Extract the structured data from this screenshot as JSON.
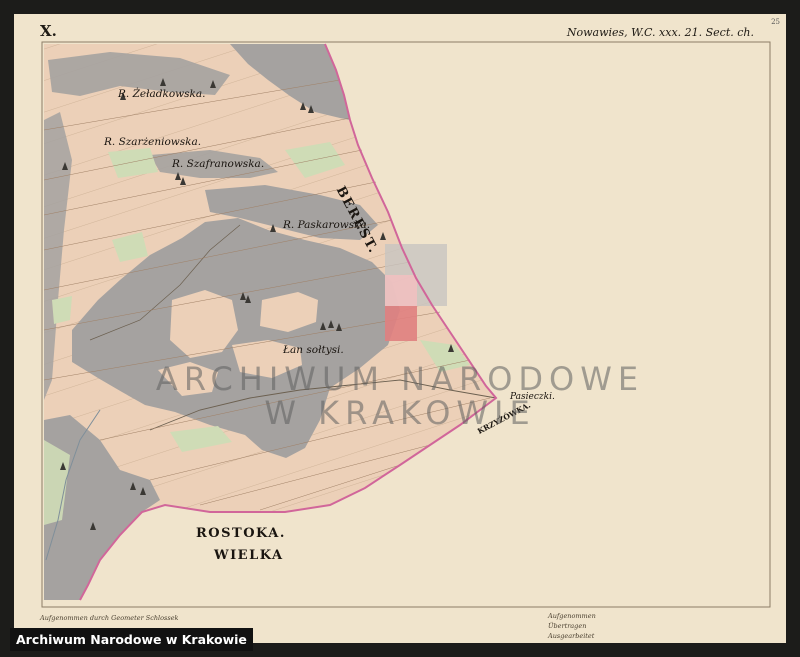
{
  "sheet": {
    "corner_label": "X.",
    "title": "Nowawies, W.C. xxx. 21. Sect. ch.",
    "page_number": "25"
  },
  "places": {
    "r_zeladkowska": "R. Żeładkowska.",
    "r_szarzeniowska": "R. Szarżeniowska.",
    "r_szafranowska": "R. Szafranowska.",
    "r_paskarowska": "R. Paskarowska.",
    "lan_soltysi": "Łan sołtysi.",
    "berest": "BEREST.",
    "pasieczki": "Pasieczki.",
    "krzyzowka": "KRZYŻÓWKA.",
    "rostoka": "ROSTOKA.",
    "wielka": "WIELKA"
  },
  "watermark": {
    "line1": "ARCHIWUM NARODOWE",
    "line2": "W KRAKOWIE"
  },
  "footer": {
    "left_note": "Aufgenommen durch Geometer Schlossek",
    "right_note_1": "Aufgenommen",
    "right_note_2": "Übertragen",
    "right_note_3": "Ausgearbeitet"
  },
  "archive_label": "Archiwum Narodowe w Krakowie",
  "colors": {
    "paper": "#f0e4cc",
    "forest": "#a5a2a0",
    "arable": "#ecd0b8",
    "meadow": "#cfdcb6",
    "boundary": "#d1669a",
    "accent_red": "#e08080"
  }
}
